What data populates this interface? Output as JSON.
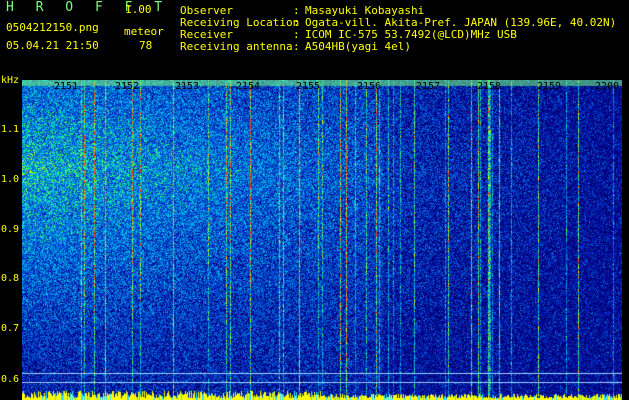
{
  "header": {
    "brand": "H R O F F T",
    "version": "1.00",
    "filename": "0504212150.png",
    "type_label": "meteor",
    "datetime": "05.04.21 21:50",
    "count": "78"
  },
  "info": [
    {
      "label": "Observer",
      "value": "Masayuki Kobayashi"
    },
    {
      "label": "Receiving Location",
      "value": "Ogata-vill. Akita-Pref. JAPAN (139.96E, 40.02N)"
    },
    {
      "label": "Receiver",
      "value": "ICOM IC-575 53.7492(@LCD)MHz USB"
    },
    {
      "label": "Receiving antenna",
      "value": "A504HB(yagi 4el)"
    }
  ],
  "spectrogram": {
    "y_unit": "kHz",
    "y_ticks": [
      "1.1",
      "1.0",
      "0.9",
      "0.8",
      "0.7",
      "0.6"
    ],
    "x_ticks": [
      "2151",
      "2152",
      "2153",
      "2154",
      "2155",
      "2156",
      "2157",
      "2158",
      "2159",
      "2200"
    ],
    "colors": {
      "background": "#00007a",
      "low": "#0030c8",
      "mid": "#00b4e6",
      "high": "#40ff60",
      "peak": "#ffff00",
      "hot": "#ff3000",
      "baseline": "#ffff00",
      "baseline_alt": "#30e0ff"
    }
  }
}
